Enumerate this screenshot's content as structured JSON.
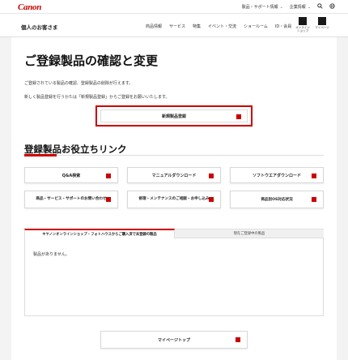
{
  "header": {
    "logo": "Canon",
    "links": [
      "製品・サポート情報",
      "企業情報"
    ],
    "search_icon": "search-icon",
    "globe_icon": "globe-icon"
  },
  "nav": {
    "title": "個人のお客さま",
    "items": [
      "商品情報",
      "サービス",
      "特集",
      "イベント・交流",
      "ショールーム",
      "ID・会員"
    ],
    "boxes": [
      "オンライン\nショップ",
      "マイページ"
    ]
  },
  "page": {
    "title": "ご登録製品の確認と変更",
    "desc1": "ご登録されている製品の確認、登録製品の削除が行えます。",
    "desc2": "新しく製品登録を行うかたは「新規製品登録」からご登録をお願いいたします。",
    "new_reg_button": "新規製品登録"
  },
  "links_section": {
    "title": "登録製品お役立ちリンク",
    "buttons": [
      "Q&A検索",
      "マニュアルダウンロード",
      "ソフトウエアダウンロード",
      "商品・サービス・サポートのお問い合わせ",
      "修理・メンテナンスのご相談・お申し込み",
      "商品別OS対応状況"
    ]
  },
  "tabs": {
    "items": [
      "キヤノンオンラインショップ・フォトハウスからご購入済で未登録の製品",
      "現在ご登録中の製品"
    ],
    "empty_message": "製品がありません。"
  },
  "mypage_button": "マイページトップ",
  "colors": {
    "accent": "#cc0000",
    "background": "#f3f3f3"
  }
}
